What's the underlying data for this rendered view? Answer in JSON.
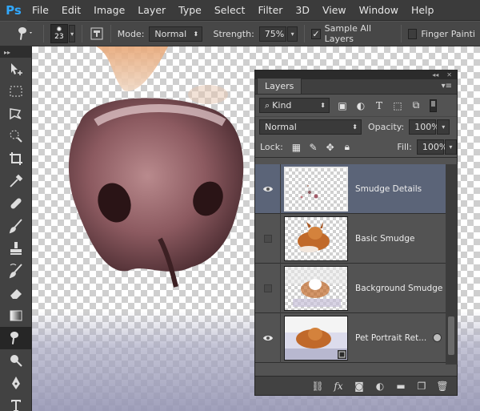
{
  "app": {
    "logo": "Ps"
  },
  "menu": [
    "File",
    "Edit",
    "Image",
    "Layer",
    "Type",
    "Select",
    "Filter",
    "3D",
    "View",
    "Window",
    "Help"
  ],
  "options": {
    "brush_size": "23",
    "mode_label": "Mode:",
    "mode_value": "Normal",
    "strength_label": "Strength:",
    "strength_value": "75%",
    "sample_all_layers_label": "Sample All Layers",
    "sample_all_layers_checked": true,
    "finger_painting_label": "Finger Painti",
    "finger_painting_checked": false
  },
  "tools": [
    "move-tool-icon",
    "marquee-tool-icon",
    "lasso-tool-icon",
    "quick-select-tool-icon",
    "crop-tool-icon",
    "eyedropper-tool-icon",
    "healing-brush-tool-icon",
    "brush-tool-icon",
    "clone-stamp-tool-icon",
    "history-brush-tool-icon",
    "eraser-tool-icon",
    "gradient-tool-icon",
    "smudge-tool-icon",
    "dodge-tool-icon",
    "pen-tool-icon",
    "type-tool-icon"
  ],
  "active_tool": "smudge-tool-icon",
  "layers_panel": {
    "tab_label": "Layers",
    "filter_kind": "Kind",
    "blend_mode": "Normal",
    "opacity_label": "Opacity:",
    "opacity_value": "100%",
    "lock_label": "Lock:",
    "fill_label": "Fill:",
    "fill_value": "100%",
    "layers": [
      {
        "name": "Smudge Details",
        "visible": true,
        "selected": true
      },
      {
        "name": "Basic Smudge",
        "visible": false,
        "selected": false
      },
      {
        "name": "Background Smudge",
        "visible": false,
        "selected": false
      },
      {
        "name": "Pet Portrait Ret...",
        "visible": true,
        "selected": false
      }
    ]
  },
  "colors": {
    "menubar": "#3b3b3b",
    "panel": "#535353",
    "selected_layer": "#5b6478",
    "ps_blue": "#31a8ff"
  }
}
